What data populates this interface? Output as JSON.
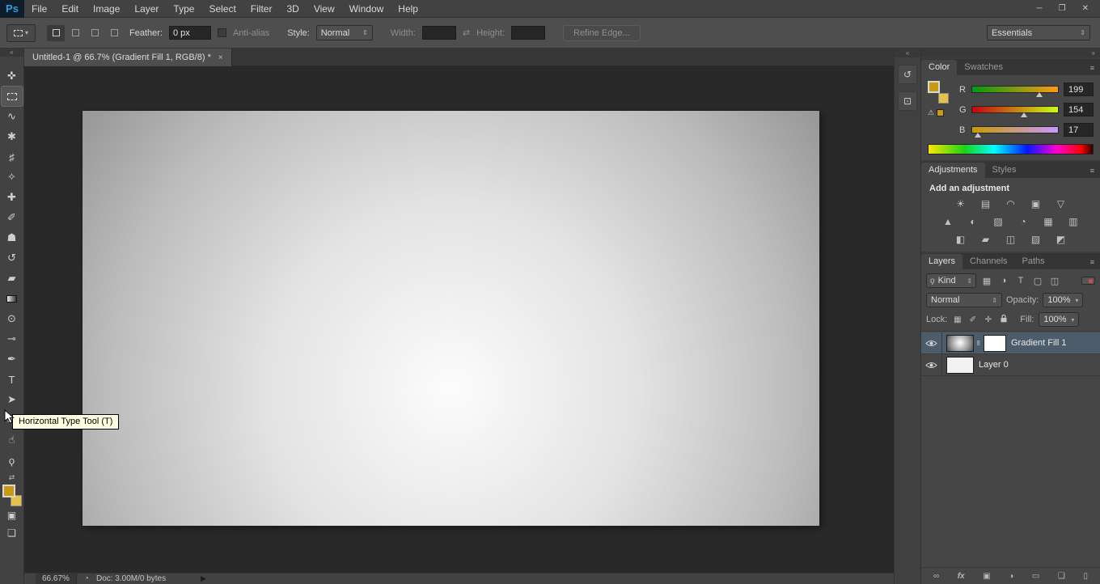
{
  "colors": {
    "foreground": "#c79a11",
    "background_swatch": "#e6c14a",
    "selected_layer": "#4d5c6b",
    "tooltip_bg": "#ffffe1"
  },
  "glyphs": {
    "dropdown": "▾",
    "stepper": "⇕",
    "panel_menu": "≡",
    "swap": "⇄",
    "chain": "∞",
    "play": "▶",
    "status": "◔",
    "search": "ϙ",
    "collapse_left": "«",
    "collapse_right": "»"
  },
  "window_controls": {
    "minimize": "─",
    "restore": "❐",
    "close": "✕"
  },
  "menubar": {
    "logo": "Ps",
    "items": [
      "File",
      "Edit",
      "Image",
      "Layer",
      "Type",
      "Select",
      "Filter",
      "3D",
      "View",
      "Window",
      "Help"
    ]
  },
  "options_bar": {
    "feather_label": "Feather:",
    "feather_value": "0 px",
    "antialias_label": "Anti-alias",
    "style_label": "Style:",
    "style_value": "Normal",
    "width_label": "Width:",
    "height_label": "Height:",
    "refine_edge_label": "Refine Edge...",
    "workspace": "Essentials"
  },
  "document_tab": {
    "title": "Untitled-1 @ 66.7% (Gradient Fill 1, RGB/8) *",
    "close": "×"
  },
  "toolbar": {
    "collapse": "«",
    "tools": [
      {
        "id": "move-tool",
        "glyph": "✜"
      },
      {
        "id": "rectangular-marquee-tool",
        "glyph": ""
      },
      {
        "id": "lasso-tool",
        "glyph": "∿"
      },
      {
        "id": "quick-selection-tool",
        "glyph": "✱"
      },
      {
        "id": "crop-tool",
        "glyph": "♯"
      },
      {
        "id": "eyedropper-tool",
        "glyph": "✧"
      },
      {
        "id": "spot-healing-brush-tool",
        "glyph": "✚"
      },
      {
        "id": "brush-tool",
        "glyph": "✐"
      },
      {
        "id": "clone-stamp-tool",
        "glyph": "☗"
      },
      {
        "id": "history-brush-tool",
        "glyph": "↺"
      },
      {
        "id": "eraser-tool",
        "glyph": "▰"
      },
      {
        "id": "gradient-tool",
        "glyph": ""
      },
      {
        "id": "blur-tool",
        "glyph": "⊙"
      },
      {
        "id": "dodge-tool",
        "glyph": "⊸"
      },
      {
        "id": "pen-tool",
        "glyph": "✒"
      },
      {
        "id": "horizontal-type-tool",
        "glyph": "T"
      },
      {
        "id": "path-selection-tool",
        "glyph": "➤"
      },
      {
        "id": "rectangle-tool",
        "glyph": "▭"
      },
      {
        "id": "hand-tool",
        "glyph": "☝"
      },
      {
        "id": "zoom-tool",
        "glyph": "ϙ"
      }
    ],
    "quick_mask_glyph": "▣",
    "screen_mode_glyph": "❏"
  },
  "tooltip": {
    "text": "Horizontal Type Tool (T)"
  },
  "status_bar": {
    "zoom": "66.67%",
    "doc_info": "Doc: 3.00M/0 bytes"
  },
  "mini_dock": {
    "expand": "«",
    "icons": [
      {
        "id": "history-panel-icon",
        "glyph": "↺"
      },
      {
        "id": "device-preview-panel-icon",
        "glyph": "⊡"
      }
    ]
  },
  "color_panel": {
    "tabs": [
      "Color",
      "Swatches"
    ],
    "gamut_warning": "⚠",
    "channels": [
      {
        "label": "R",
        "value": "199"
      },
      {
        "label": "G",
        "value": "154"
      },
      {
        "label": "B",
        "value": "17"
      }
    ]
  },
  "adjustments_panel": {
    "tabs": [
      "Adjustments",
      "Styles"
    ],
    "header": "Add an adjustment",
    "icons": [
      {
        "id": "brightness-contrast",
        "glyph": "☀"
      },
      {
        "id": "levels",
        "glyph": "▤"
      },
      {
        "id": "curves",
        "glyph": "◠"
      },
      {
        "id": "exposure",
        "glyph": "▣"
      },
      {
        "id": "vibrance",
        "glyph": "▽"
      },
      {
        "id": "hue-saturation",
        "glyph": "▲"
      },
      {
        "id": "color-balance",
        "glyph": "◐"
      },
      {
        "id": "black-white",
        "glyph": "▨"
      },
      {
        "id": "photo-filter",
        "glyph": "◔"
      },
      {
        "id": "channel-mixer",
        "glyph": "▦"
      },
      {
        "id": "color-lookup",
        "glyph": "▥"
      },
      {
        "id": "invert",
        "glyph": "◧"
      },
      {
        "id": "posterize",
        "glyph": "▰"
      },
      {
        "id": "threshold",
        "glyph": "◫"
      },
      {
        "id": "selective-color",
        "glyph": "▧"
      },
      {
        "id": "gradient-map",
        "glyph": "◩"
      }
    ]
  },
  "layers_panel": {
    "tabs": [
      "Layers",
      "Channels",
      "Paths"
    ],
    "filter": {
      "kind_label": "Kind",
      "icons": [
        {
          "id": "filter-pixel-layers-icon",
          "glyph": "▦"
        },
        {
          "id": "filter-adjustment-layers-icon",
          "glyph": "◑"
        },
        {
          "id": "filter-type-layers-icon",
          "glyph": "T"
        },
        {
          "id": "filter-shape-layers-icon",
          "glyph": "▢"
        },
        {
          "id": "filter-smart-objects-icon",
          "glyph": "◫"
        }
      ]
    },
    "blend_mode": "Normal",
    "opacity_label": "Opacity:",
    "opacity_value": "100%",
    "lock_label": "Lock:",
    "lock_icons": [
      {
        "id": "lock-transparency-icon",
        "glyph": "▦"
      },
      {
        "id": "lock-pixels-icon",
        "glyph": "✐"
      },
      {
        "id": "lock-position-icon",
        "glyph": "✛"
      }
    ],
    "fill_label": "Fill:",
    "fill_value": "100%",
    "layers": [
      {
        "name": "Gradient Fill 1",
        "selected": true
      },
      {
        "name": "Layer 0",
        "selected": false
      }
    ],
    "bottom_icons": [
      {
        "id": "link-layers-icon",
        "glyph": "∞"
      },
      {
        "id": "layer-style-icon",
        "glyph": "fx"
      },
      {
        "id": "add-layer-mask-icon",
        "glyph": "▣"
      },
      {
        "id": "new-adjustment-layer-icon",
        "glyph": "◑"
      },
      {
        "id": "new-group-icon",
        "glyph": "▭"
      },
      {
        "id": "new-layer-icon",
        "glyph": "❏"
      },
      {
        "id": "delete-layer-icon",
        "glyph": "▯"
      }
    ]
  }
}
